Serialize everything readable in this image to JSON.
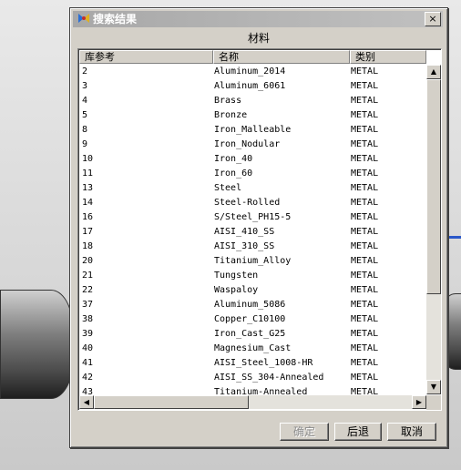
{
  "dialog": {
    "title": "搜索结果",
    "caption": "材料",
    "close_label": "×"
  },
  "table": {
    "columns": [
      "库参考",
      "名称",
      "类别"
    ],
    "rows": [
      [
        "2",
        "Aluminum_2014",
        "METAL"
      ],
      [
        "3",
        "Aluminum_6061",
        "METAL"
      ],
      [
        "4",
        "Brass",
        "METAL"
      ],
      [
        "5",
        "Bronze",
        "METAL"
      ],
      [
        "8",
        "Iron_Malleable",
        "METAL"
      ],
      [
        "9",
        "Iron_Nodular",
        "METAL"
      ],
      [
        "10",
        "Iron_40",
        "METAL"
      ],
      [
        "11",
        "Iron_60",
        "METAL"
      ],
      [
        "13",
        "Steel",
        "METAL"
      ],
      [
        "14",
        "Steel-Rolled",
        "METAL"
      ],
      [
        "16",
        "S/Steel_PH15-5",
        "METAL"
      ],
      [
        "17",
        "AISI_410_SS",
        "METAL"
      ],
      [
        "18",
        "AISI_310_SS",
        "METAL"
      ],
      [
        "20",
        "Titanium_Alloy",
        "METAL"
      ],
      [
        "21",
        "Tungsten",
        "METAL"
      ],
      [
        "22",
        "Waspaloy",
        "METAL"
      ],
      [
        "37",
        "Aluminum_5086",
        "METAL"
      ],
      [
        "38",
        "Copper_C10100",
        "METAL"
      ],
      [
        "39",
        "Iron_Cast_G25",
        "METAL"
      ],
      [
        "40",
        "Magnesium_Cast",
        "METAL"
      ],
      [
        "41",
        "AISI_Steel_1008-HR",
        "METAL"
      ],
      [
        "42",
        "AISI_SS_304-Annealed",
        "METAL"
      ],
      [
        "43",
        "Titanium-Annealed",
        "METAL"
      ]
    ]
  },
  "scrollbars": {
    "up": "▲",
    "down": "▼",
    "left": "◀",
    "right": "▶"
  },
  "buttons": {
    "ok": "确定",
    "back": "后退",
    "cancel": "取消"
  }
}
